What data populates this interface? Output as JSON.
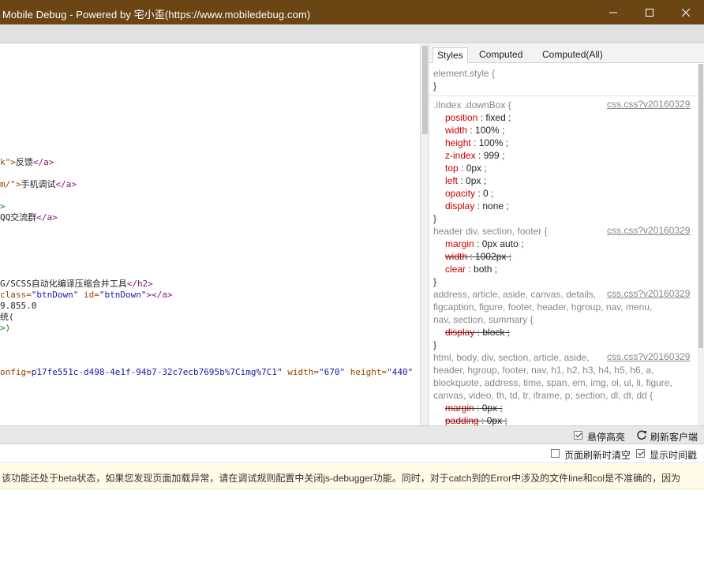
{
  "window": {
    "title": "Mobile Debug - Powered by 宅小歪(https://www.mobiledebug.com)",
    "minimize_icon": "minimize-icon",
    "maximize_icon": "maximize-icon",
    "close_icon": "close-icon"
  },
  "source": {
    "lines": [
      {
        "parts": [
          [
            "attr",
            "k\">"
          ],
          [
            "txt",
            "反馈"
          ],
          [
            "tag",
            "</a>"
          ]
        ]
      },
      {
        "parts": [
          [
            "attr",
            "m/\">"
          ],
          [
            "txt",
            "手机调试"
          ],
          [
            "tag",
            "</a>"
          ]
        ]
      },
      {
        "parts": [
          [
            "grn",
            ">"
          ]
        ]
      },
      {
        "parts": [
          [
            "txt",
            "QQ交流群"
          ],
          [
            "tag",
            "</a>"
          ]
        ]
      },
      {
        "parts": [
          [
            "txt",
            "G/SCSS自动化编译压缩合并工具"
          ],
          [
            "tag",
            "</h2>"
          ]
        ]
      },
      {
        "parts": [
          [
            "attr",
            "class="
          ],
          [
            "val",
            "\"btnDown\""
          ],
          [
            "attr",
            " id="
          ],
          [
            "val",
            "\"btnDown\""
          ],
          [
            "tag",
            "></a>"
          ]
        ]
      },
      {
        "parts": [
          [
            "txt",
            "9.855.0"
          ]
        ]
      },
      {
        "parts": [
          [
            "txt",
            "统("
          ]
        ]
      },
      {
        "parts": [
          [
            "grn",
            ">)"
          ]
        ]
      },
      {
        "parts": [
          [
            "attr",
            "onfig="
          ],
          [
            "val",
            "p17fe551c-d498-4e1f-94b7-32c7ecb7695b%7Cimg%7C1\""
          ],
          [
            "attr",
            " width="
          ],
          [
            "val",
            "\"670\""
          ],
          [
            "attr",
            " height="
          ],
          [
            "val",
            "\"440\""
          ]
        ]
      }
    ]
  },
  "styles_panel": {
    "tabs": [
      "Styles",
      "Computed",
      "Computed(All)"
    ],
    "active_tab": "Styles",
    "rules": [
      {
        "selector": [
          "element.style {"
        ],
        "source": "",
        "props": []
      },
      {
        "selector": [
          ".iIndex .downBox {"
        ],
        "source": "css.css?v20160329",
        "props": [
          {
            "name": "position",
            "value": "fixed",
            "struck": false
          },
          {
            "name": "width",
            "value": "100%",
            "struck": false
          },
          {
            "name": "height",
            "value": "100%",
            "struck": false
          },
          {
            "name": "z-index",
            "value": "999",
            "struck": false
          },
          {
            "name": "top",
            "value": "0px",
            "struck": false
          },
          {
            "name": "left",
            "value": "0px",
            "struck": false
          },
          {
            "name": "opacity",
            "value": "0",
            "struck": false
          },
          {
            "name": "display",
            "value": "none",
            "struck": false
          }
        ]
      },
      {
        "selector": [
          "header div, section, footer {"
        ],
        "source": "css.css?v20160329",
        "props": [
          {
            "name": "margin",
            "value": "0px auto",
            "struck": false
          },
          {
            "name": "width",
            "value": "1002px",
            "struck": true
          },
          {
            "name": "clear",
            "value": "both",
            "struck": false
          }
        ]
      },
      {
        "selector": [
          "address, article, aside, canvas, details,",
          "figcaption, figure, footer, header, hgroup, nav, menu,",
          "nav, section, summary {"
        ],
        "source": "css.css?v20160329",
        "props": [
          {
            "name": "display",
            "value": "block",
            "struck": true
          }
        ]
      },
      {
        "selector": [
          "html, body, div, section, article, aside,",
          "header, hgroup, footer, nav, h1, h2, h3, h4, h5, h6, a,",
          "blockquote, address, time, span, em, img, ol, ul, li, figure,",
          "canvas, video, th, td, tr, iframe, p, section, dl, dt, dd {"
        ],
        "source": "css.css?v20160329",
        "props": [
          {
            "name": "margin",
            "value": "0px",
            "struck": true
          },
          {
            "name": "padding",
            "value": "0px",
            "struck": true
          }
        ]
      }
    ]
  },
  "toolbar1": {
    "hover_highlight_label": "悬停高亮",
    "hover_highlight_checked": true,
    "refresh_client_label": "刷新客户端",
    "refresh_icon": "refresh-icon"
  },
  "toolbar2": {
    "clear_on_refresh_label": "页面刷新时清空",
    "clear_on_refresh_checked": false,
    "show_time_label": "显示时间戳",
    "show_time_checked": true
  },
  "notice": {
    "text": "该功能还处于beta状态，如果您发现页面加载异常，请在调试规则配置中关闭js-debugger功能。同时，对于catch到的Error中涉及的文件line和col是不准确的，因为"
  }
}
